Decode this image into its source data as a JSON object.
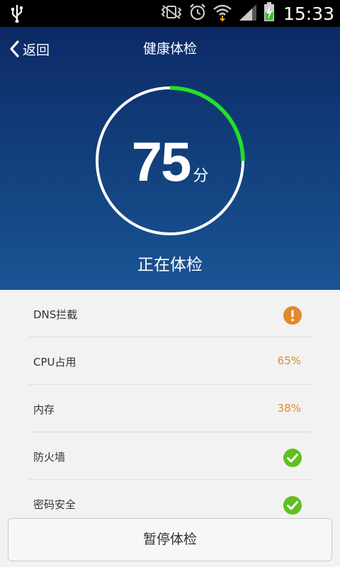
{
  "status_bar": {
    "time": "15:33",
    "icons": [
      "usb-icon",
      "vibrate-icon",
      "alarm-icon",
      "wifi-icon",
      "signal-icon",
      "battery-charging-icon"
    ]
  },
  "header": {
    "back_label": "返回",
    "title": "健康体检"
  },
  "score": {
    "value": "75",
    "unit": "分",
    "progress_fraction": 0.25,
    "progress_color": "#22e02a"
  },
  "scan_status": "正在体检",
  "checks": [
    {
      "label": "DNS拦截",
      "type": "icon",
      "icon": "warning-icon",
      "color": "#e08a2e"
    },
    {
      "label": "CPU占用",
      "type": "text",
      "value": "65%",
      "color": "#e08a2e"
    },
    {
      "label": "内存",
      "type": "text",
      "value": "38%",
      "color": "#e08a2e"
    },
    {
      "label": "防火墙",
      "type": "icon",
      "icon": "check-icon",
      "color": "#5fc01e"
    },
    {
      "label": "密码安全",
      "type": "icon",
      "icon": "check-icon",
      "color": "#5fc01e"
    }
  ],
  "pause_button_label": "暂停体检"
}
